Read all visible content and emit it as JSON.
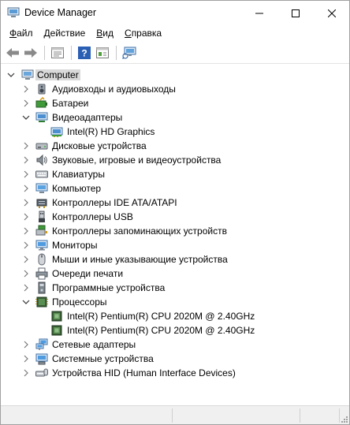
{
  "window": {
    "title": "Device Manager"
  },
  "menu": [
    {
      "accel": "Ф",
      "rest": "айл"
    },
    {
      "accel": "Д",
      "rest": "ействие"
    },
    {
      "accel": "В",
      "rest": "ид"
    },
    {
      "accel": "С",
      "rest": "правка"
    }
  ],
  "toolbar": [
    "back-arrow-icon",
    "forward-arrow-icon",
    "properties-icon",
    "help-icon",
    "update-driver-icon",
    "scan-hardware-icon"
  ],
  "tree": {
    "root": {
      "label": "Computer",
      "expanded": true
    },
    "categories": [
      {
        "label": "Аудиовходы и аудиовыходы",
        "icon": "speaker-icon",
        "expanded": false
      },
      {
        "label": "Батареи",
        "icon": "battery-icon",
        "expanded": false
      },
      {
        "label": "Видеоадаптеры",
        "icon": "display-adapter-icon",
        "expanded": true,
        "children": [
          "Intel(R) HD Graphics"
        ]
      },
      {
        "label": "Дисковые устройства",
        "icon": "disk-drive-icon",
        "expanded": false
      },
      {
        "label": "Звуковые, игровые и видеоустройства",
        "icon": "sound-icon",
        "expanded": false
      },
      {
        "label": "Клавиатуры",
        "icon": "keyboard-icon",
        "expanded": false
      },
      {
        "label": "Компьютер",
        "icon": "computer-icon",
        "expanded": false
      },
      {
        "label": "Контроллеры IDE ATA/ATAPI",
        "icon": "ide-controller-icon",
        "expanded": false
      },
      {
        "label": "Контроллеры USB",
        "icon": "usb-icon",
        "expanded": false
      },
      {
        "label": "Контроллеры запоминающих устройств",
        "icon": "storage-controller-icon",
        "expanded": false
      },
      {
        "label": "Мониторы",
        "icon": "monitor-icon",
        "expanded": false
      },
      {
        "label": "Мыши и иные указывающие устройства",
        "icon": "mouse-icon",
        "expanded": false
      },
      {
        "label": "Очереди печати",
        "icon": "printer-icon",
        "expanded": false
      },
      {
        "label": "Программные устройства",
        "icon": "software-device-icon",
        "expanded": false
      },
      {
        "label": "Процессоры",
        "icon": "processor-icon",
        "expanded": true,
        "children": [
          "Intel(R) Pentium(R) CPU 2020M @ 2.40GHz",
          "Intel(R) Pentium(R) CPU 2020M @ 2.40GHz"
        ]
      },
      {
        "label": "Сетевые адаптеры",
        "icon": "network-adapter-icon",
        "expanded": false
      },
      {
        "label": "Системные устройства",
        "icon": "system-device-icon",
        "expanded": false
      },
      {
        "label": "Устройства HID (Human Interface Devices)",
        "icon": "hid-icon",
        "expanded": false
      }
    ]
  }
}
